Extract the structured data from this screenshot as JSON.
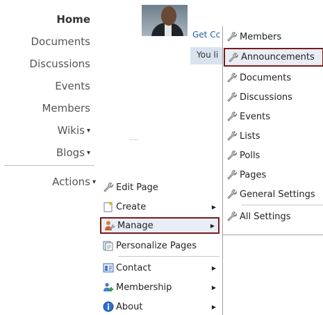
{
  "nav": {
    "items": [
      {
        "label": "Home",
        "active": true,
        "dropdown": false
      },
      {
        "label": "Documents",
        "active": false,
        "dropdown": false
      },
      {
        "label": "Discussions",
        "active": false,
        "dropdown": false
      },
      {
        "label": "Events",
        "active": false,
        "dropdown": false
      },
      {
        "label": "Members",
        "active": false,
        "dropdown": false
      },
      {
        "label": "Wikis",
        "active": false,
        "dropdown": true
      },
      {
        "label": "Blogs",
        "active": false,
        "dropdown": true
      },
      {
        "label": "Actions",
        "active": false,
        "dropdown": true
      }
    ],
    "dropdown_caret": "▾"
  },
  "profile": {
    "link_text": "Get Cc",
    "like_text": "You li"
  },
  "actions_menu": {
    "items": [
      {
        "label": "Edit Page",
        "icon": "wrench-icon"
      },
      {
        "label": "Create",
        "icon": "create-icon",
        "submenu": true
      },
      {
        "label": "Manage",
        "icon": "manage-icon",
        "submenu": true,
        "highlighted": true
      },
      {
        "label": "Personalize Pages",
        "icon": "personalize-icon"
      },
      {
        "label": "Contact",
        "icon": "contact-icon",
        "submenu": true
      },
      {
        "label": "Membership",
        "icon": "membership-icon",
        "submenu": true
      },
      {
        "label": "About",
        "icon": "info-icon",
        "submenu": true
      }
    ],
    "submenu_arrow": "▶"
  },
  "manage_submenu": {
    "items": [
      {
        "label": "Members",
        "icon": "wrench-icon"
      },
      {
        "label": "Announcements",
        "icon": "wrench-icon",
        "highlighted": true
      },
      {
        "label": "Documents",
        "icon": "wrench-icon"
      },
      {
        "label": "Discussions",
        "icon": "wrench-icon"
      },
      {
        "label": "Events",
        "icon": "wrench-icon"
      },
      {
        "label": "Lists",
        "icon": "wrench-icon"
      },
      {
        "label": "Polls",
        "icon": "wrench-icon"
      },
      {
        "label": "Pages",
        "icon": "wrench-icon"
      },
      {
        "label": "General Settings",
        "icon": "wrench-icon"
      },
      {
        "label": "All Settings",
        "icon": "wrench-icon"
      }
    ]
  },
  "colors": {
    "highlight_border": "#7a1a1a",
    "highlight_bg": "#e9eef6",
    "link": "#1d5fa9"
  }
}
